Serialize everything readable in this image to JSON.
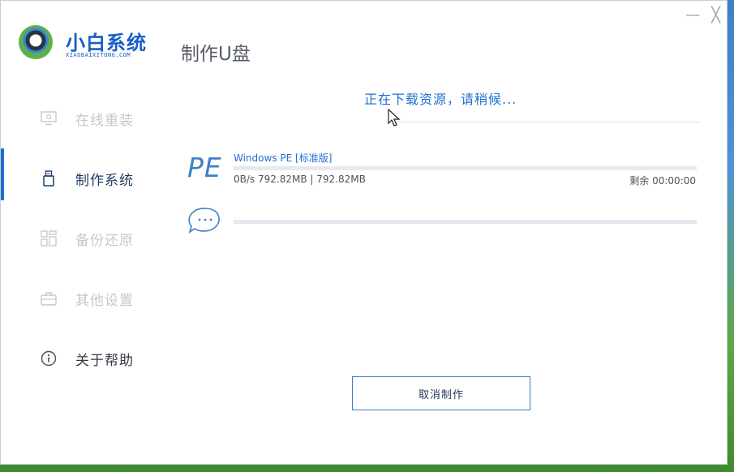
{
  "app": {
    "logo_name": "小白系统",
    "logo_sub": "XIAOBAIXITONG.COM",
    "page_title": "制作U盘",
    "minimize_glyph": "—",
    "close_glyph": "╳"
  },
  "sidebar": {
    "items": [
      {
        "label": "在线重装",
        "icon": "monitor-icon",
        "state": "disabled"
      },
      {
        "label": "制作系统",
        "icon": "usb-icon",
        "state": "active"
      },
      {
        "label": "备份还原",
        "icon": "grid-icon",
        "state": "disabled"
      },
      {
        "label": "其他设置",
        "icon": "briefcase-icon",
        "state": "disabled"
      },
      {
        "label": "关于帮助",
        "icon": "info-icon",
        "state": "normal"
      }
    ]
  },
  "main": {
    "status_text": "正在下载资源，请稍候...",
    "pe_logo": "PE",
    "download": {
      "name": "Windows PE [标准版]",
      "stats": "0B/s 792.82MB | 792.82MB",
      "remaining": "剩余 00:00:00",
      "progress": 0
    },
    "second_task_progress": 0,
    "cancel_label": "取消制作"
  },
  "colors": {
    "accent": "#1f6fd0",
    "disabled_text": "#c4c8cd",
    "track": "#e5eaf0"
  }
}
